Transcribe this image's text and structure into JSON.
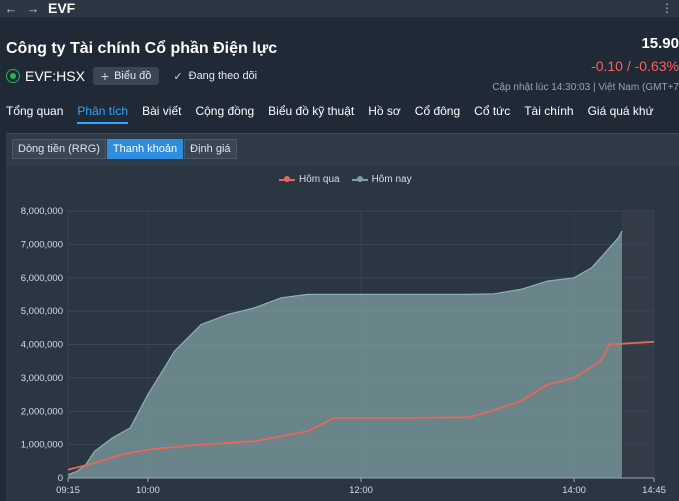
{
  "header": {
    "back_icon": "arrow-left-icon",
    "forward_icon": "arrow-right-icon",
    "ticker": "EVF",
    "menu_icon": "more-icon"
  },
  "company": {
    "name": "Công ty Tài chính Cổ phần Điện lực",
    "exchange_code": "EVF:HSX",
    "chart_button": "Biểu đồ",
    "follow_label": "Đang theo dõi",
    "price": "15.90",
    "change": "-0.10 / -0.63%",
    "updated": "Cập nhật lúc  14:30:03 | Việt Nam (GMT+7"
  },
  "tabs": [
    "Tổng quan",
    "Phân tích",
    "Bài viết",
    "Cộng đồng",
    "Biểu đồ kỹ thuật",
    "Hồ sơ",
    "Cổ đông",
    "Cổ tức",
    "Tài chính",
    "Giá quá khứ"
  ],
  "active_tab": "Phân tích",
  "subtabs": [
    "Dòng tiền (RRG)",
    "Thanh khoản",
    "Định giá"
  ],
  "active_subtab": "Thanh khoản",
  "colors": {
    "yesterday": "#e8675a",
    "today": "#7fa0a0",
    "active_tab": "#2ea7ff",
    "price_change": "#ff5f5f"
  },
  "chart_data": {
    "type": "area",
    "legend": [
      "Hôm qua",
      "Hôm nay"
    ],
    "y_ticks": [
      "0",
      "1,000,000",
      "2,000,000",
      "3,000,000",
      "4,000,000",
      "5,000,000",
      "6,000,000",
      "7,000,000",
      "8,000,000"
    ],
    "ylim": [
      0,
      8000000
    ],
    "x_ticks": [
      "09:15",
      "10:00",
      "12:00",
      "14:00",
      "14:45"
    ],
    "grid": true,
    "legend_position": "top",
    "series": [
      {
        "name": "Hôm qua",
        "x": [
          "09:15",
          "09:30",
          "09:45",
          "10:00",
          "10:30",
          "11:00",
          "11:30",
          "11:45",
          "12:00",
          "12:30",
          "13:00",
          "13:10",
          "13:30",
          "13:45",
          "14:00",
          "14:15",
          "14:20",
          "14:45"
        ],
        "values": [
          250000,
          450000,
          700000,
          850000,
          1000000,
          1100000,
          1400000,
          1800000,
          1800000,
          1800000,
          1820000,
          1950000,
          2300000,
          2800000,
          3000000,
          3500000,
          4000000,
          4080000
        ]
      },
      {
        "name": "Hôm nay",
        "x": [
          "09:15",
          "09:20",
          "09:25",
          "09:30",
          "09:40",
          "09:50",
          "10:00",
          "10:15",
          "10:30",
          "10:45",
          "11:00",
          "11:15",
          "11:30",
          "12:00",
          "12:30",
          "13:00",
          "13:15",
          "13:30",
          "13:45",
          "14:00",
          "14:10",
          "14:15",
          "14:20",
          "14:25",
          "14:27"
        ],
        "values": [
          100000,
          200000,
          400000,
          800000,
          1200000,
          1500000,
          2500000,
          3800000,
          4600000,
          4900000,
          5100000,
          5400000,
          5500000,
          5500000,
          5500000,
          5500000,
          5520000,
          5650000,
          5900000,
          6000000,
          6300000,
          6600000,
          6900000,
          7200000,
          7400000
        ]
      }
    ]
  }
}
